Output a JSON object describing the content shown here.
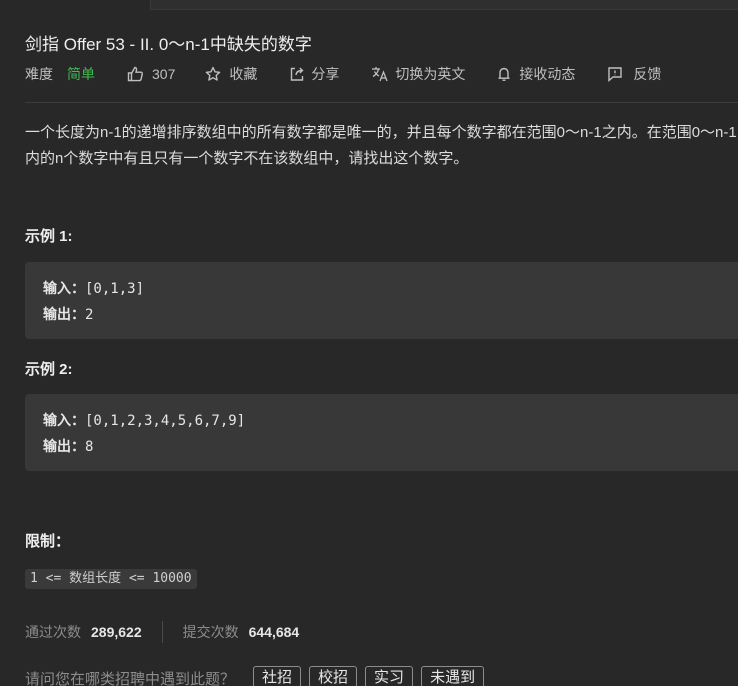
{
  "title": "剑指 Offer 53 - II. 0～n-1中缺失的数字",
  "meta": {
    "difficulty_label": "难度",
    "difficulty_value": "简单",
    "likes": "307",
    "favorite_label": "收藏",
    "share_label": "分享",
    "translate_label": "切换为英文",
    "notify_label": "接收动态",
    "feedback_label": "反馈"
  },
  "description": "一个长度为n-1的递增排序数组中的所有数字都是唯一的，并且每个数字都在范围0～n-1之内。在范围0～n-1内的n个数字中有且只有一个数字不在该数组中，请找出这个数字。",
  "examples": [
    {
      "title": "示例 1:",
      "input_label": "输入：",
      "input": "[0,1,3]",
      "output_label": "输出：",
      "output": "2"
    },
    {
      "title": "示例 2:",
      "input_label": "输入：",
      "input": "[0,1,2,3,4,5,6,7,9]",
      "output_label": "输出：",
      "output": "8"
    }
  ],
  "constraints": {
    "title": "限制：",
    "items": [
      "1 <= 数组长度 <= 10000"
    ]
  },
  "stats": {
    "accepted_label": "通过次数",
    "accepted_value": "289,622",
    "submissions_label": "提交次数",
    "submissions_value": "644,684"
  },
  "company": {
    "question": "请问您在哪类招聘中遇到此题？",
    "tags": [
      "社招",
      "校招",
      "实习",
      "未遇到"
    ]
  },
  "colors": {
    "background": "#282828",
    "easy": "#3fb950",
    "code_bg": "#383838"
  },
  "icons": [
    "thumbs-up-icon",
    "star-icon",
    "share-icon",
    "translate-icon",
    "bell-icon",
    "feedback-icon"
  ]
}
